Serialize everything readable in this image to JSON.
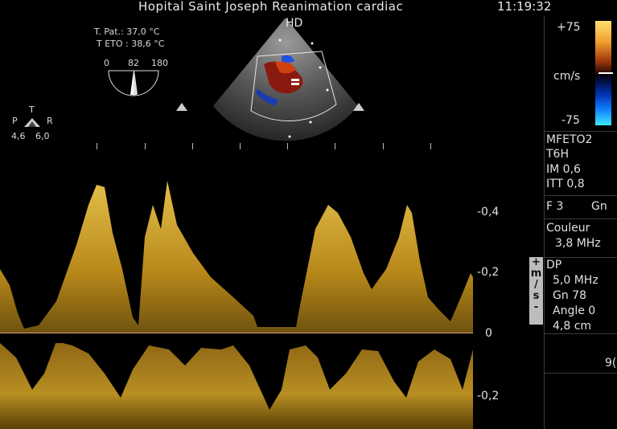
{
  "header": {
    "hospital": "Hopital Saint Joseph Reanimation cardiac",
    "time": "11:19:32"
  },
  "temperature": {
    "patient": "T. Pat.: 37,0 °C",
    "eto": "T ETO : 38,6 °C"
  },
  "probe_angle": {
    "min": "0",
    "value": "82",
    "max": "180"
  },
  "orientation": {
    "top": "T",
    "left": "P",
    "right": "R",
    "left_value": "4,6",
    "right_value": "6,0"
  },
  "image_label": "HD",
  "color_scale": {
    "max": "+75",
    "unit": "cm/s",
    "min": "-75"
  },
  "settings": {
    "probe": "MFETO2",
    "preset": "T6H",
    "im": "IM 0,6",
    "itt": "ITT 0,8",
    "frame": "F 3",
    "gain_short": "Gn",
    "couleur_label": "Couleur",
    "couleur_freq": "3,8 MHz",
    "dp_label": "DP",
    "dp_freq": "5,0 MHz",
    "dp_gain": "Gn 78",
    "angle": "Angle 0",
    "depth": "4,8 cm",
    "partial": "9("
  },
  "velocity_axis": {
    "labels": [
      "-0,4",
      "-0,2",
      "0",
      "-0,2"
    ],
    "unit_box": [
      "+",
      "m",
      "/",
      "s",
      "-"
    ]
  }
}
